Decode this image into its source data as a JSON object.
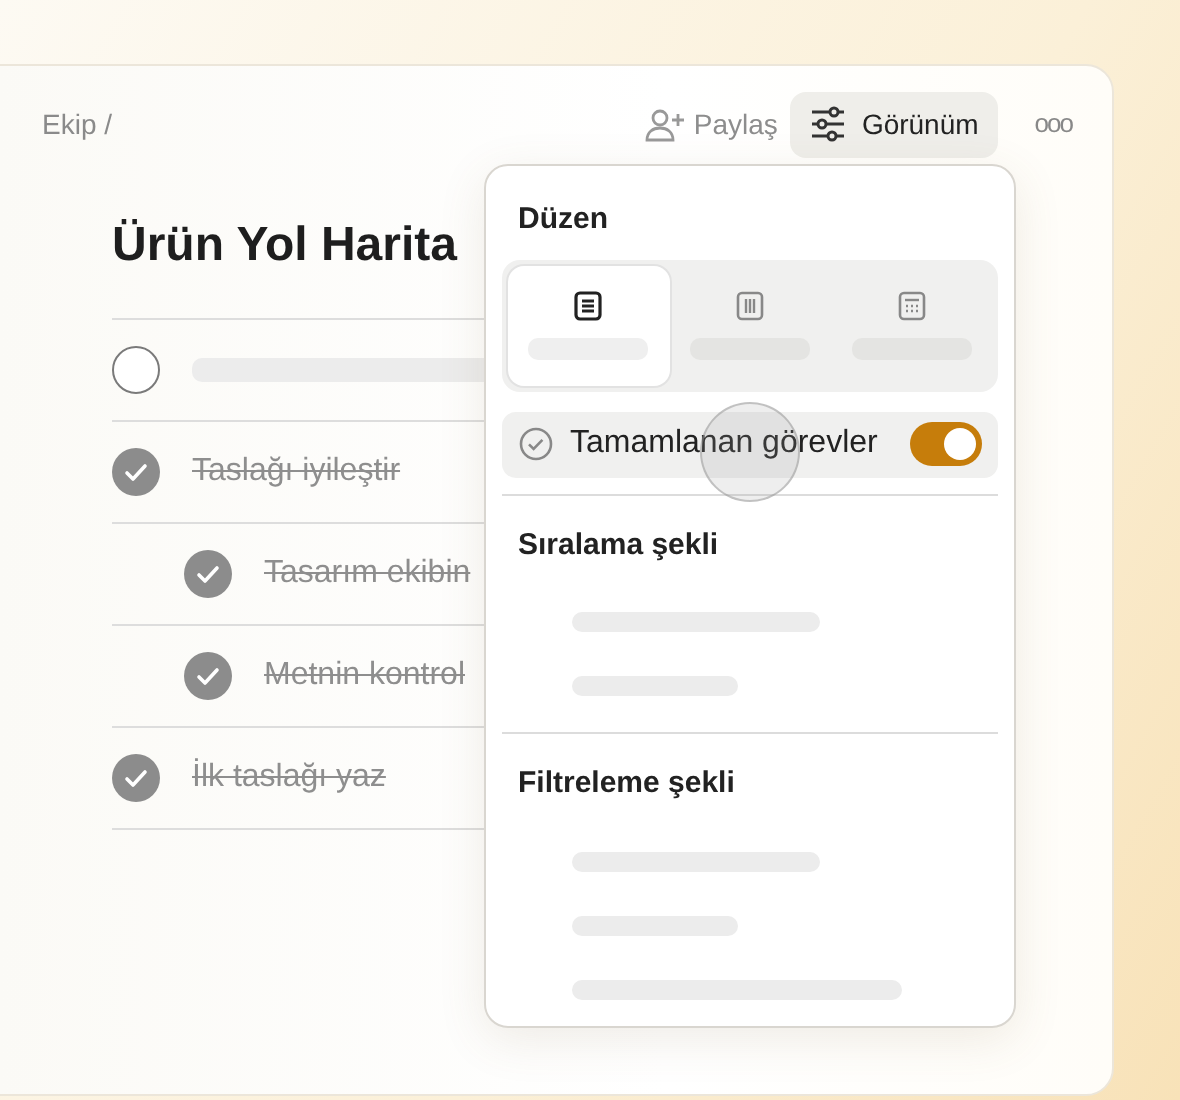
{
  "breadcrumb": "Ekip /",
  "header": {
    "share": "Paylaş",
    "view": "Görünüm",
    "more": "ooo",
    "view_open": true
  },
  "page": {
    "title": "Ürün Yol Harita"
  },
  "tasks": [
    {
      "kind": "placeholder",
      "checked": false
    },
    {
      "kind": "task",
      "text": "Taslağı iyileştir",
      "checked": true,
      "children": [
        {
          "kind": "task",
          "text": "Tasarım ekibin",
          "checked": true
        },
        {
          "kind": "task",
          "text": "Metnin kontrol",
          "checked": true
        }
      ]
    },
    {
      "kind": "task",
      "text": "İlk taslağı yaz",
      "checked": true
    }
  ],
  "view_menu": {
    "layout_title": "Düzen",
    "layouts": [
      {
        "selected": true
      },
      {
        "selected": false
      },
      {
        "selected": false
      }
    ],
    "completed_toggle": {
      "label": "Tamamlanan görevler",
      "on": true
    },
    "sort_title": "Sıralama şekli",
    "sort_options": [
      {
        "kind": "placeholder"
      },
      {
        "kind": "placeholder"
      }
    ],
    "filter_title": "Filtreleme şekli",
    "filter_options": [
      {
        "kind": "placeholder"
      },
      {
        "kind": "placeholder"
      },
      {
        "kind": "placeholder"
      }
    ]
  }
}
